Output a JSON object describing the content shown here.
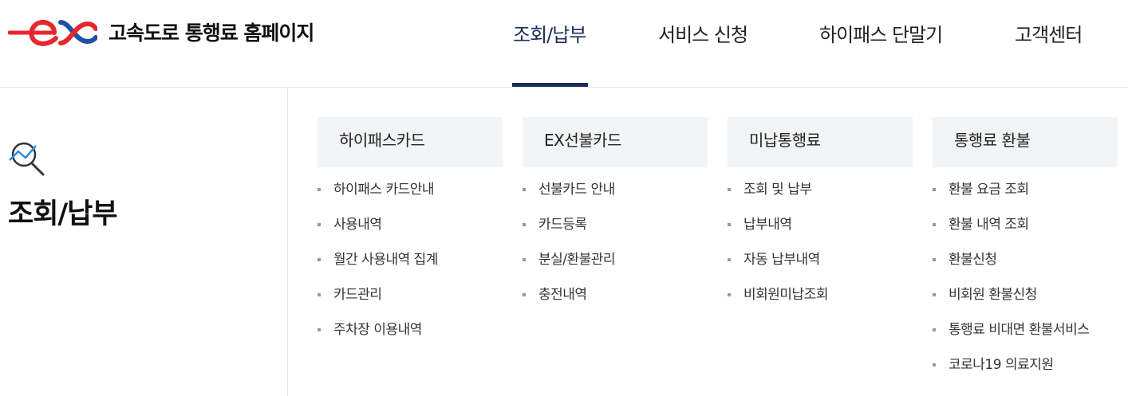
{
  "site": {
    "title": "고속도로 통행료 홈페이지",
    "logo_text": "ex"
  },
  "gnb": {
    "items": [
      {
        "label": "조회/납부",
        "active": true
      },
      {
        "label": "서비스 신청"
      },
      {
        "label": "하이패스 단말기"
      },
      {
        "label": "고객센터"
      }
    ]
  },
  "side": {
    "icon": "search-chart-icon",
    "title": "조회/납부"
  },
  "menu": {
    "columns": [
      {
        "heading": "하이패스카드",
        "items": [
          "하이패스 카드안내",
          "사용내역",
          "월간 사용내역 집계",
          "카드관리",
          "주차장 이용내역"
        ]
      },
      {
        "heading": "EX선불카드",
        "items": [
          "선불카드 안내",
          "카드등록",
          "분실/환불관리",
          "충전내역"
        ]
      },
      {
        "heading": "미납통행료",
        "items": [
          "조회 및 납부",
          "납부내역",
          "자동 납부내역",
          "비회원미납조회"
        ]
      },
      {
        "heading": "통행료 환불",
        "items": [
          "환불 요금 조회",
          "환불 내역 조회",
          "환불신청",
          "비회원 환불신청",
          "통행료 비대면 환불서비스",
          "코로나19 의료지원"
        ]
      }
    ]
  },
  "colors": {
    "brand_red": "#e8262d",
    "brand_blue": "#1f4fa8",
    "nav_active": "#1d2d5e",
    "panel_bg": "#f3f4f6"
  }
}
